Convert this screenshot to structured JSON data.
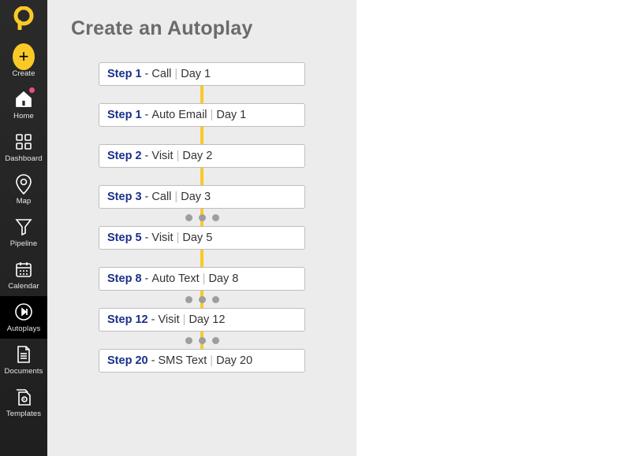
{
  "sidebar": {
    "items": [
      {
        "id": "create",
        "label": "Create"
      },
      {
        "id": "home",
        "label": "Home"
      },
      {
        "id": "dashboard",
        "label": "Dashboard"
      },
      {
        "id": "map",
        "label": "Map"
      },
      {
        "id": "pipeline",
        "label": "Pipeline"
      },
      {
        "id": "calendar",
        "label": "Calendar"
      },
      {
        "id": "autoplays",
        "label": "Autoplays"
      },
      {
        "id": "documents",
        "label": "Documents"
      },
      {
        "id": "templates",
        "label": "Templates"
      }
    ]
  },
  "page": {
    "title": "Create an Autoplay"
  },
  "steps": [
    {
      "step": "Step 1",
      "action": "Call",
      "day": "Day 1"
    },
    {
      "step": "Step 1",
      "action": "Auto Email",
      "day": "Day 1"
    },
    {
      "step": "Step 2",
      "action": "Visit",
      "day": "Day 2"
    },
    {
      "step": "Step 3",
      "action": "Call",
      "day": "Day 3"
    },
    {
      "step": "Step 5",
      "action": "Visit",
      "day": "Day 5"
    },
    {
      "step": "Step 8",
      "action": "Auto Text",
      "day": "Day 8"
    },
    {
      "step": "Step 12",
      "action": "Visit",
      "day": "Day 12"
    },
    {
      "step": "Step 20",
      "action": "SMS Text",
      "day": "Day 20"
    }
  ]
}
